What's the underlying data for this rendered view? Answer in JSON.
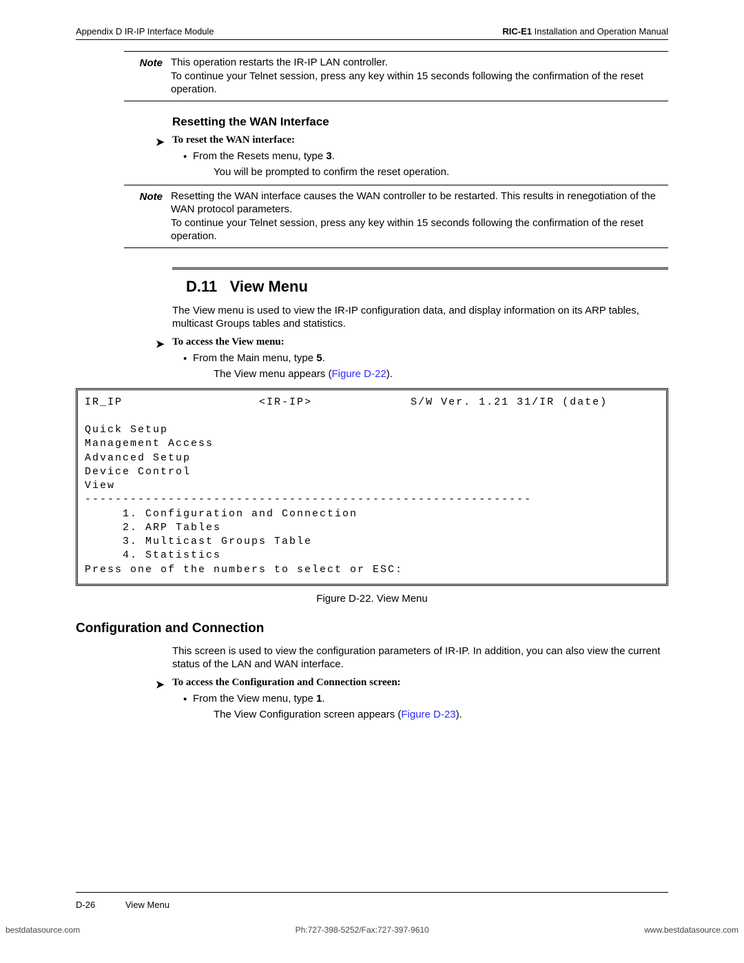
{
  "header": {
    "left": "Appendix D  IR-IP Interface Module",
    "right_bold": "RIC-E1",
    "right_rest": " Installation and Operation Manual"
  },
  "note1": {
    "label": "Note",
    "text": "This operation restarts the IR-IP LAN controller.\nTo continue your Telnet session, press any key within 15 seconds following the confirmation of the reset operation."
  },
  "h3_reset": "Resetting the WAN Interface",
  "proc_reset": "To reset the WAN interface:",
  "bullet_reset_pre": "From the Resets menu, type ",
  "bullet_reset_b": "3",
  "bullet_reset_post": ".",
  "indent_reset": "You will be prompted to confirm the reset operation.",
  "note2": {
    "label": "Note",
    "text": "Resetting the WAN interface causes the WAN controller to be restarted. This results in renegotiation of the WAN protocol parameters.\nTo continue your Telnet session, press any key within 15 seconds following the confirmation of the reset operation."
  },
  "section_num": "D.11",
  "section_title": "View Menu",
  "view_intro": "The View menu is used to view the IR-IP configuration data, and display information on its ARP tables, multicast Groups tables and statistics.",
  "proc_view": "To access the View menu:",
  "bullet_view_pre": "From the Main menu, type ",
  "bullet_view_b": "5",
  "bullet_view_post": ".",
  "indent_view_pre": "The View menu appears (",
  "indent_view_link": "Figure D-22",
  "indent_view_post": ").",
  "menu": {
    "row1_left": "IR_IP",
    "row1_mid": "<IR-IP>",
    "row1_right": "S/W Ver. 1.21 31/IR (date)",
    "items_top": [
      "Quick Setup",
      "Management Access",
      "Advanced Setup",
      "Device Control",
      "View"
    ],
    "sep": "-----------------------------------------------------------",
    "items_num": [
      "1. Configuration and Connection",
      "2. ARP Tables",
      "3. Multicast Groups Table",
      "4. Statistics"
    ],
    "prompt": "Press one of the numbers to select or ESC:"
  },
  "fig_caption": "Figure D-22.  View Menu",
  "h2b": "Configuration and Connection",
  "cc_intro": "This screen is used to view the configuration parameters of IR-IP. In addition, you can also view the current status of the LAN and WAN interface.",
  "proc_cc": "To access the Configuration and Connection screen:",
  "bullet_cc_pre": "From the View menu, type ",
  "bullet_cc_b": "1",
  "bullet_cc_post": ".",
  "indent_cc_pre": "The View Configuration screen appears (",
  "indent_cc_link": "Figure D-23",
  "indent_cc_post": ").",
  "footer": {
    "page": "D-26",
    "title": "View Menu"
  },
  "site": {
    "left": "bestdatasource.com",
    "mid": "Ph:727-398-5252/Fax:727-397-9610",
    "right": "www.bestdatasource.com"
  }
}
